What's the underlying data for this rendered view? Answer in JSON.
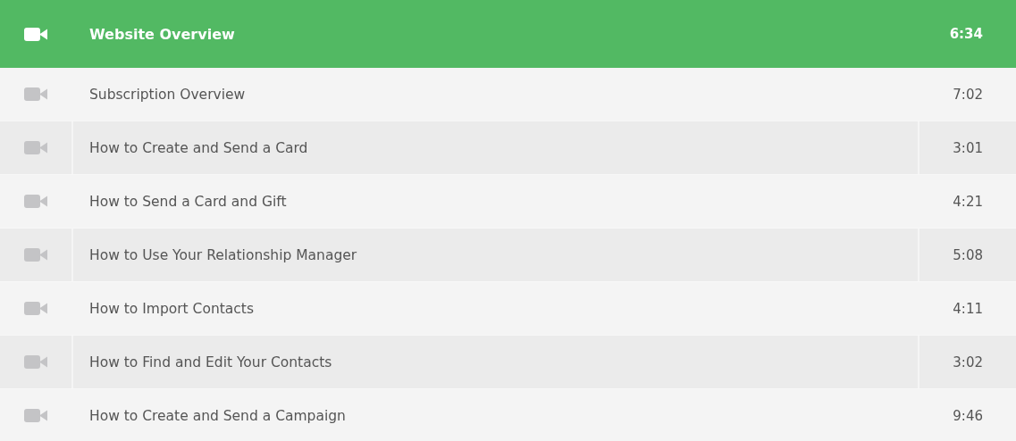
{
  "lessons": [
    {
      "title": "Website Overview",
      "duration": "6:34",
      "selected": true
    },
    {
      "title": "Subscription Overview",
      "duration": "7:02",
      "selected": false
    },
    {
      "title": "How to Create and Send a Card",
      "duration": "3:01",
      "selected": false
    },
    {
      "title": "How to Send a Card and Gift",
      "duration": "4:21",
      "selected": false
    },
    {
      "title": "How to Use Your Relationship Manager",
      "duration": "5:08",
      "selected": false
    },
    {
      "title": "How to Import Contacts",
      "duration": "4:11",
      "selected": false
    },
    {
      "title": "How to Find and Edit Your Contacts",
      "duration": "3:02",
      "selected": false
    },
    {
      "title": "How to Create and Send a Campaign",
      "duration": "9:46",
      "selected": false
    }
  ]
}
